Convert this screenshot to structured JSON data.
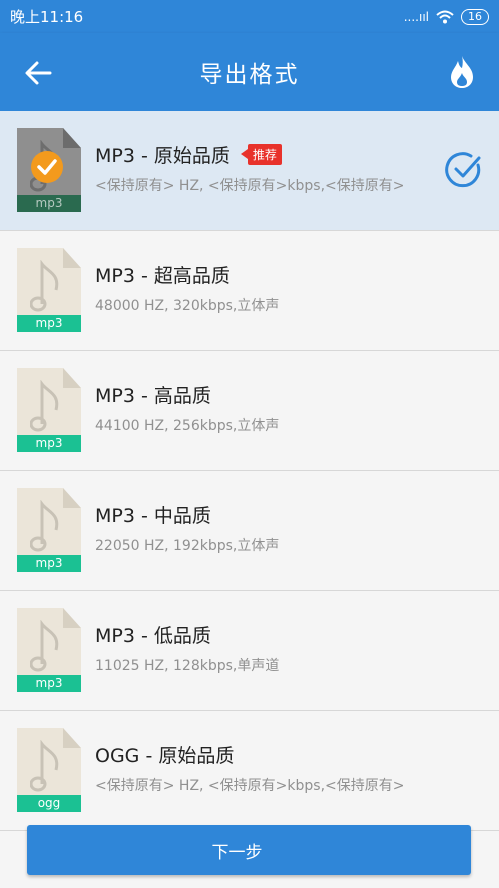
{
  "status_bar": {
    "time": "晚上11:16",
    "signal": "....ııl",
    "battery": "16"
  },
  "header": {
    "title": "导出格式"
  },
  "items": [
    {
      "name": "MP3 - 原始品质",
      "desc": "<保持原有> HZ, <保持原有>kbps,<保持原有>",
      "ext": "mp3",
      "badge": "推荐",
      "selected": true
    },
    {
      "name": "MP3 - 超高品质",
      "desc": "48000 HZ, 320kbps,立体声",
      "ext": "mp3"
    },
    {
      "name": "MP3 - 高品质",
      "desc": "44100 HZ, 256kbps,立体声",
      "ext": "mp3"
    },
    {
      "name": "MP3 - 中品质",
      "desc": "22050 HZ, 192kbps,立体声",
      "ext": "mp3"
    },
    {
      "name": "MP3 - 低品质",
      "desc": "11025 HZ, 128kbps,单声道",
      "ext": "mp3"
    },
    {
      "name": "OGG - 原始品质",
      "desc": "<保持原有> HZ, <保持原有>kbps,<保持原有>",
      "ext": "ogg"
    }
  ],
  "next_button": {
    "label": "下一步"
  },
  "colors": {
    "primary": "#2f86d8",
    "tag": "#1bc193",
    "badge": "#e8322b",
    "check_orange": "#f39a1d"
  },
  "icons": {
    "back": "arrow-left-icon",
    "fire": "flame-icon",
    "file": "music-file-icon",
    "selected": "check-circle-icon"
  }
}
